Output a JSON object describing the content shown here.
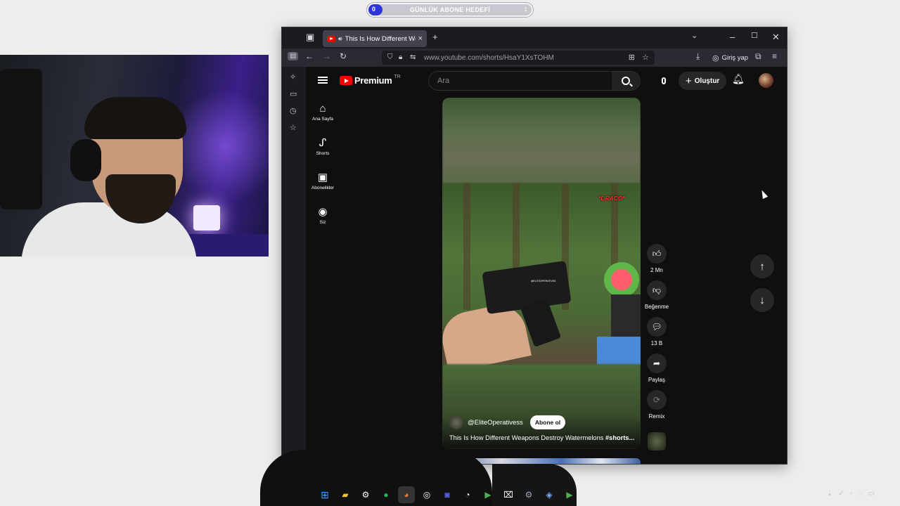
{
  "overlay": {
    "goal_label": "GÜNLÜK ABONE HEDEFİ",
    "goal_current": "0",
    "goal_target": "1"
  },
  "browser": {
    "tab_title": "This Is How Different Weapo",
    "url": "www.youtube.com/shorts/HsaY1XsTOHM",
    "signin_label": "Giriş yap"
  },
  "youtube": {
    "logo_text": "Premium",
    "country_code": "TR",
    "search_placeholder": "Ara",
    "create_label": "Oluştur",
    "nav": [
      {
        "label": "Ana Sayfa",
        "icon": "home-icon"
      },
      {
        "label": "Shorts",
        "icon": "shorts-icon"
      },
      {
        "label": "Abonelikler",
        "icon": "subscriptions-icon"
      },
      {
        "label": "Siz",
        "icon": "you-icon"
      }
    ],
    "short": {
      "overlay_tag": "*DRACO*",
      "watermark": "@ELITEOPERATIVES",
      "channel": "@EliteOperativess",
      "subscribe_label": "Abone ol",
      "caption": "This Is How Different Weapons Destroy Watermelons",
      "caption_hashtag": "#shorts..."
    },
    "actions": [
      {
        "label": "2 Mn",
        "icon": "like-icon"
      },
      {
        "label": "Beğenme",
        "icon": "dislike-icon"
      },
      {
        "label": "13 B",
        "icon": "comment-icon"
      },
      {
        "label": "Paylaş",
        "icon": "share-icon"
      },
      {
        "label": "Remix",
        "icon": "remix-icon"
      }
    ]
  },
  "colors": {
    "yt_red": "#ff0000",
    "goal_blue": "#2c35d6",
    "page_bg": "#0f0f0f"
  }
}
